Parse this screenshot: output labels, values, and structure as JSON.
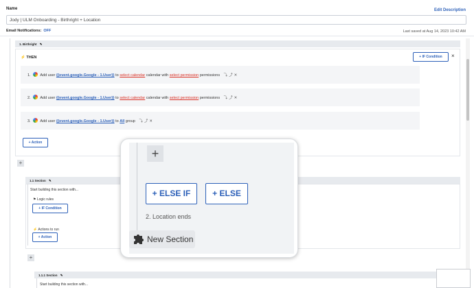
{
  "header": {
    "name_label": "Name",
    "edit_description": "Edit Description",
    "name_value": "Jody | ULM Onboarding - Birthright + Location",
    "email_label": "Email Notifications:",
    "email_value": "OFF",
    "last_saved": "Last saved at Aug 14, 2023 10:42 AM"
  },
  "birthright": {
    "title": "1. Birthright",
    "then_label": "THEN",
    "if_condition": "+ IF Condition",
    "close": "×",
    "actions": [
      {
        "num": "1.",
        "pre": "Add user",
        "user": "{{event.google.Google - 1.User}}",
        "to": "to",
        "target": "select calendar",
        "mid": "calendar with",
        "perm": "select permission",
        "post": "permissions"
      },
      {
        "num": "2.",
        "pre": "Add user",
        "user": "{{event.google.Google - 1.User}}",
        "to": "to",
        "target": "select calendar",
        "mid": "calendar with",
        "perm": "select permission",
        "post": "permissions"
      },
      {
        "num": "3.",
        "pre": "Add user",
        "user": "{{event.google.Google - 1.User}}",
        "to": "to",
        "target": "All",
        "mid": "group",
        "perm": "",
        "post": ""
      }
    ],
    "add_action": "+ Action"
  },
  "section_1_1": {
    "title": "1.1 Section",
    "start": "Start building this section with...",
    "logic_rules": "Logic rules",
    "if_condition": "+ IF Condition",
    "actions_to_run": "Actions to run",
    "add_action": "+ Action"
  },
  "section_1_1_1": {
    "title": "1.1.1 Section",
    "start": "Start building this section with..."
  },
  "zoom": {
    "else_if": "+ ELSE IF",
    "else": "+ ELSE",
    "location_ends": "2. Location ends",
    "new_section": "New Section"
  }
}
